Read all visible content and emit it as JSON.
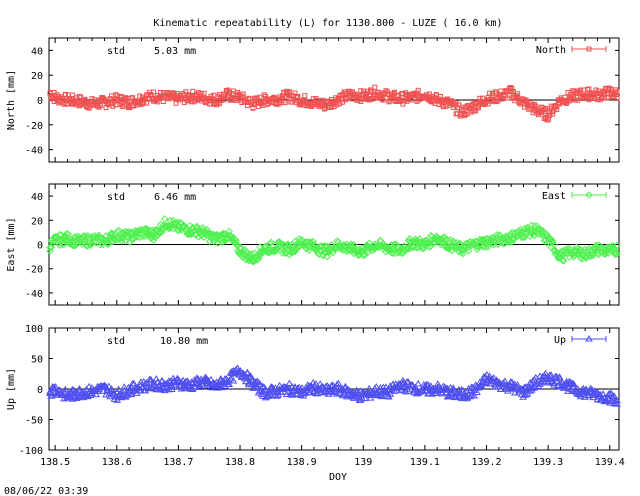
{
  "title": "Kinematic repeatability (L) for 1130.800 - LUZE  ( 16.0 km)",
  "footer": "08/06/22 03:39",
  "xlabel": "DOY",
  "x_tick_labels": [
    "138.5",
    "138.6",
    "138.7",
    "138.8",
    "138.9",
    "139",
    "139.1",
    "139.2",
    "139.3",
    "139.4"
  ],
  "chart_data": [
    {
      "type": "line",
      "name": "North",
      "ylabel": "North [mm]",
      "std_label": "std",
      "std_value": "5.03 mm",
      "color": "#f05050",
      "marker": "square",
      "xlim": [
        138.49,
        139.415
      ],
      "ylim": [
        -50,
        50
      ],
      "y_ticks": [
        40,
        20,
        0,
        -20,
        -40
      ],
      "x": [
        138.49,
        138.5,
        138.52,
        138.54,
        138.56,
        138.58,
        138.6,
        138.62,
        138.64,
        138.66,
        138.68,
        138.7,
        138.72,
        138.74,
        138.76,
        138.78,
        138.8,
        138.82,
        138.84,
        138.86,
        138.88,
        138.9,
        138.92,
        138.94,
        138.96,
        138.98,
        139.0,
        139.02,
        139.04,
        139.06,
        139.08,
        139.1,
        139.12,
        139.14,
        139.16,
        139.18,
        139.2,
        139.22,
        139.24,
        139.26,
        139.28,
        139.3,
        139.32,
        139.34,
        139.36,
        139.38,
        139.4,
        139.415
      ],
      "y": [
        6,
        2,
        0,
        -1,
        -3,
        -2,
        0,
        -2,
        1,
        3,
        2,
        1,
        3,
        2,
        0,
        4,
        2,
        -3,
        0,
        1,
        3,
        0,
        -2,
        -4,
        1,
        4,
        3,
        6,
        3,
        1,
        2,
        5,
        0,
        -3,
        -10,
        -5,
        1,
        3,
        6,
        -2,
        -8,
        -12,
        0,
        3,
        5,
        4,
        6,
        4
      ]
    },
    {
      "type": "line",
      "name": "East",
      "ylabel": "East [mm]",
      "std_label": "std",
      "std_value": "6.46 mm",
      "color": "#50f050",
      "marker": "diamond",
      "xlim": [
        138.49,
        139.415
      ],
      "ylim": [
        -50,
        50
      ],
      "y_ticks": [
        40,
        20,
        0,
        -20,
        -40
      ],
      "x": [
        138.49,
        138.5,
        138.52,
        138.54,
        138.56,
        138.58,
        138.6,
        138.62,
        138.64,
        138.66,
        138.68,
        138.7,
        138.72,
        138.74,
        138.76,
        138.78,
        138.8,
        138.82,
        138.84,
        138.86,
        138.88,
        138.9,
        138.92,
        138.94,
        138.96,
        138.98,
        139.0,
        139.02,
        139.04,
        139.06,
        139.08,
        139.1,
        139.12,
        139.14,
        139.16,
        139.18,
        139.2,
        139.22,
        139.24,
        139.26,
        139.28,
        139.3,
        139.32,
        139.34,
        139.36,
        139.38,
        139.4,
        139.415
      ],
      "y": [
        -2,
        3,
        5,
        2,
        4,
        3,
        8,
        6,
        10,
        8,
        18,
        14,
        12,
        10,
        4,
        8,
        -5,
        -12,
        -3,
        -2,
        -4,
        2,
        -2,
        -6,
        0,
        -4,
        -6,
        0,
        -3,
        -5,
        2,
        0,
        6,
        0,
        -4,
        0,
        2,
        4,
        6,
        10,
        12,
        4,
        -10,
        -6,
        -8,
        -4,
        -6,
        -3
      ]
    },
    {
      "type": "line",
      "name": "Up",
      "ylabel": "Up [mm]",
      "std_label": "std",
      "std_value": "10.80 mm",
      "color": "#5050f0",
      "marker": "triangle",
      "xlim": [
        138.49,
        139.415
      ],
      "ylim": [
        -100,
        100
      ],
      "y_ticks": [
        100,
        50,
        0,
        -50,
        -100
      ],
      "x": [
        138.49,
        138.5,
        138.52,
        138.54,
        138.56,
        138.58,
        138.6,
        138.62,
        138.64,
        138.66,
        138.68,
        138.7,
        138.72,
        138.74,
        138.76,
        138.78,
        138.8,
        138.82,
        138.84,
        138.86,
        138.88,
        138.9,
        138.92,
        138.94,
        138.96,
        138.98,
        139.0,
        139.02,
        139.04,
        139.06,
        139.08,
        139.1,
        139.12,
        139.14,
        139.16,
        139.18,
        139.2,
        139.22,
        139.24,
        139.26,
        139.28,
        139.3,
        139.32,
        139.34,
        139.36,
        139.38,
        139.4,
        139.415
      ],
      "y": [
        -5,
        0,
        -12,
        -6,
        -4,
        0,
        -10,
        -2,
        4,
        8,
        6,
        10,
        6,
        12,
        4,
        14,
        30,
        10,
        -6,
        -4,
        0,
        -6,
        2,
        -4,
        0,
        -8,
        -12,
        -4,
        -6,
        6,
        2,
        -2,
        0,
        -6,
        -10,
        -4,
        16,
        8,
        4,
        -6,
        10,
        18,
        12,
        0,
        -6,
        -10,
        -14,
        -24
      ]
    }
  ]
}
